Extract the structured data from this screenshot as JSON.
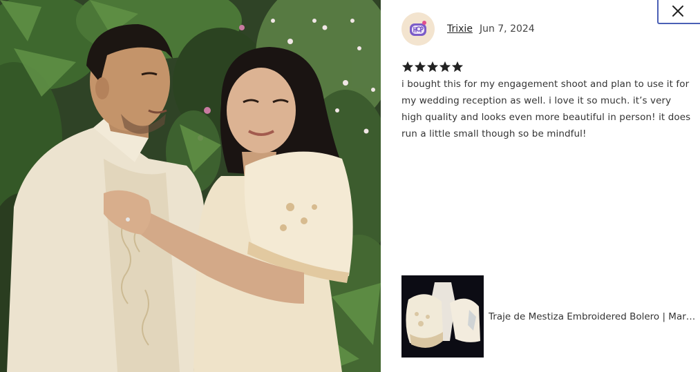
{
  "photo": {
    "icon": "review-photo"
  },
  "close": {
    "icon": "close-icon"
  },
  "review": {
    "reviewer_name": "Trixie",
    "date": "Jun 7, 2024",
    "rating": 5,
    "rating_max": 5,
    "text": "i bought this for my engagement shoot and plan to use it for my wedding reception as well. i love it so much. it’s very high quality and looks even more beautiful in person! it does run a little small though so be mindful!",
    "avatar_icon": "avatar-icon"
  },
  "product": {
    "title": "Traje de Mestiza Embroidered Bolero | Maria Clara",
    "thumb_icon": "product-thumbnail"
  },
  "colors": {
    "star": "#222222",
    "close_border": "#4a5fb5",
    "avatar_bg": "#f3e4cf",
    "avatar_fg": "#7b5cc8"
  }
}
